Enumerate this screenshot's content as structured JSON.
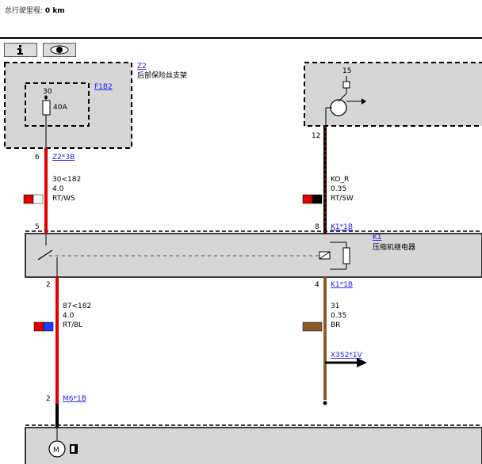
{
  "header": {
    "odometer_label": "总行驶里程:",
    "odometer_value": "0 km"
  },
  "toolbar": {
    "info_icon": "info-icon",
    "view_icon": "eye-icon"
  },
  "components": {
    "z2": {
      "id": "Z2",
      "name": "后部保险丝支架"
    },
    "fuse": {
      "id": "F1B2",
      "pin": "30",
      "rating": "40A"
    },
    "k1": {
      "id": "K1",
      "name": "压缩机继电器"
    },
    "right_box": {
      "pin": "15"
    }
  },
  "left_top": {
    "pin": "6",
    "connector": "Z2*3B",
    "signal": "30<182",
    "gauge": "4.0",
    "color": "RT/WS",
    "colors": [
      "#e00000",
      "#ffffff"
    ]
  },
  "left_k1": {
    "pin": "5"
  },
  "right_top": {
    "pin": "12",
    "signal": "KO_R",
    "gauge": "0.35",
    "color": "RT/SW",
    "colors": [
      "#e00000",
      "#000000"
    ]
  },
  "right_k1": {
    "pin": "8",
    "connector": "K1*1B"
  },
  "left_bottom": {
    "pin": "2",
    "signal": "87<182",
    "gauge": "4.0",
    "color": "RT/BL",
    "colors": [
      "#e00000",
      "#1a3cff"
    ]
  },
  "right_bottom": {
    "pin": "4",
    "connector": "K1*1B",
    "signal": "31",
    "gauge": "0.35",
    "color": "BR",
    "colors": [
      "#8b5a2b",
      "#8b5a2b"
    ]
  },
  "ground_link": {
    "connector": "X352*1V"
  },
  "motor": {
    "pin": "2",
    "connector": "M6*1B"
  }
}
